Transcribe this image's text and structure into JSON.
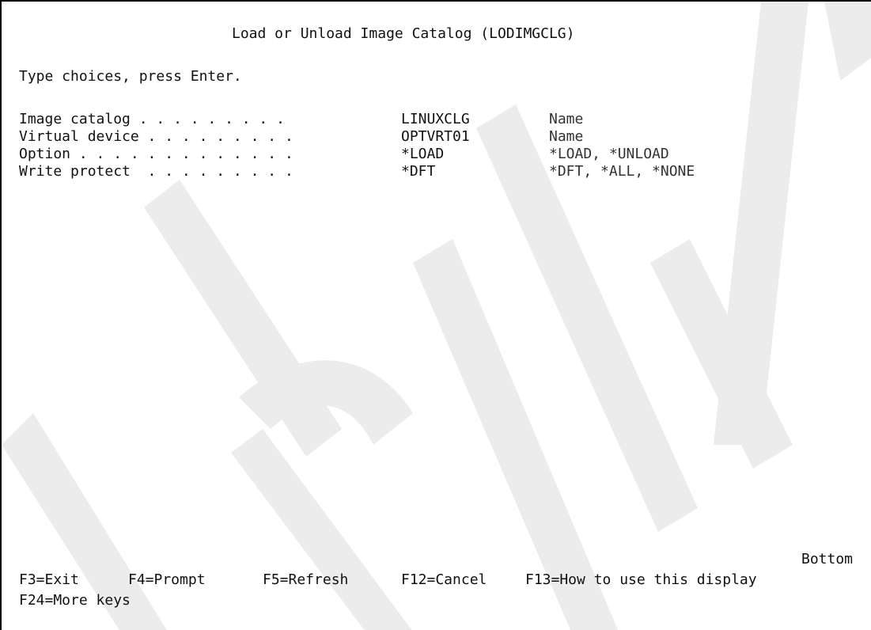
{
  "screen": {
    "title": "Load or Unload Image Catalog (LODIMGCLG)",
    "instruction": "Type choices, press Enter.",
    "fields": [
      {
        "label": "Image catalog . . . . . . . . .",
        "value": "LINUXCLG",
        "hint": "Name"
      },
      {
        "label": "Virtual device . . . . . . . . .",
        "value": "OPTVRT01",
        "hint": "Name"
      },
      {
        "label": "Option . . . . . . . . . . . . .",
        "value": "*LOAD",
        "hint": "*LOAD, *UNLOAD"
      },
      {
        "label": "Write protect  . . . . . . . . .",
        "value": "*DFT",
        "hint": "*DFT, *ALL, *NONE"
      }
    ],
    "position_indicator": "Bottom",
    "function_keys_row1": [
      {
        "label": "F3=Exit"
      },
      {
        "label": "F4=Prompt"
      },
      {
        "label": "F5=Refresh"
      },
      {
        "label": "F12=Cancel"
      },
      {
        "label": "F13=How to use this display"
      }
    ],
    "function_keys_row2": [
      {
        "label": "F24=More keys"
      }
    ]
  },
  "colors": {
    "background": "#ffffff",
    "text": "#111111",
    "border": "#000000",
    "watermark": "#e9e9e9"
  }
}
